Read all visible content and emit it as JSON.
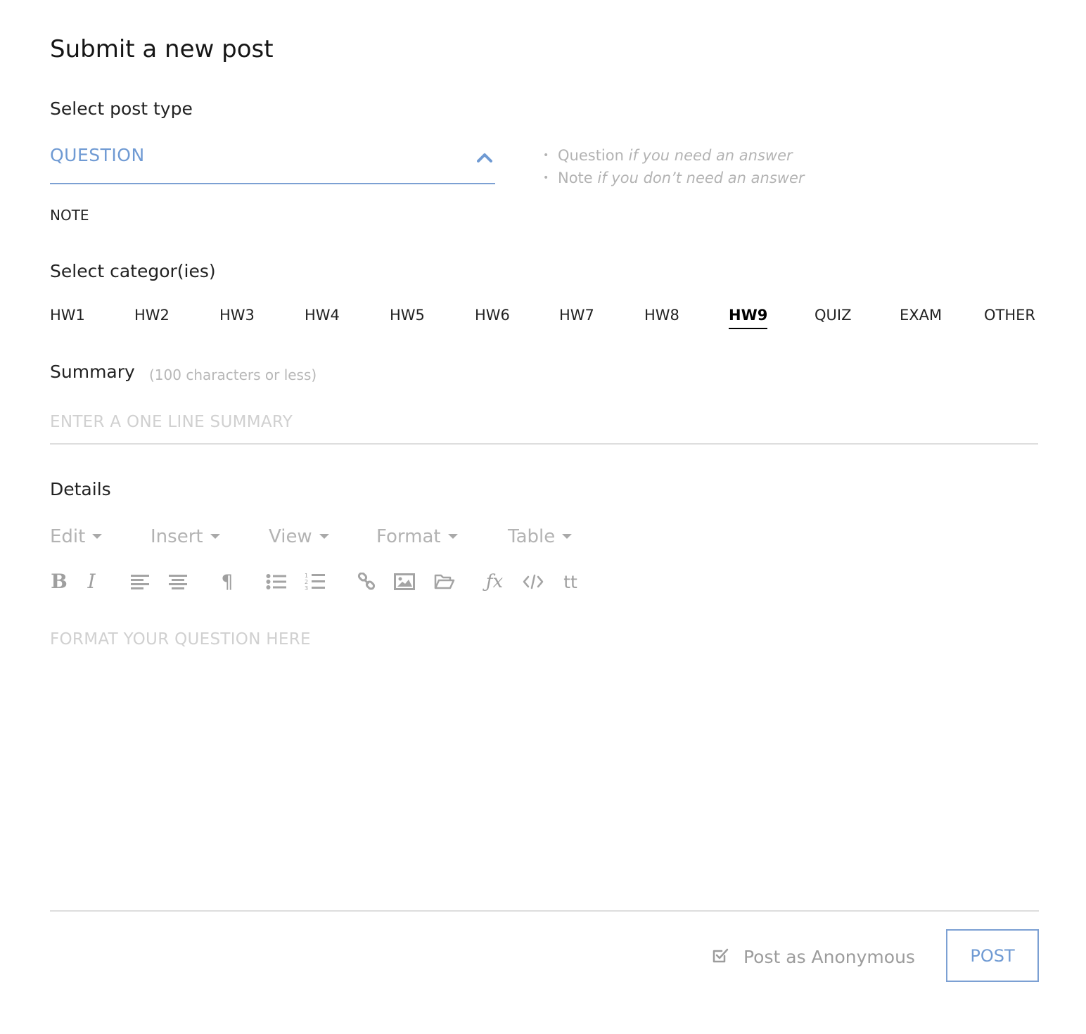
{
  "page": {
    "title": "Submit a new post"
  },
  "post_type": {
    "label": "Select post type",
    "selected": "QUESTION",
    "options": [
      "NOTE"
    ],
    "hints": [
      {
        "name": "Question",
        "desc": "if you need an answer"
      },
      {
        "name": "Note",
        "desc": "if you don’t need an answer"
      }
    ],
    "accent_color": "#6f9ad3"
  },
  "categories": {
    "label": "Select categor(ies)",
    "items": [
      "HW1",
      "HW2",
      "HW3",
      "HW4",
      "HW5",
      "HW6",
      "HW7",
      "HW8",
      "HW9",
      "QUIZ",
      "EXAM",
      "OTHER"
    ],
    "selected": "HW9"
  },
  "summary": {
    "label": "Summary",
    "hint": "(100 characters or less)",
    "placeholder": "ENTER A ONE LINE SUMMARY",
    "value": ""
  },
  "details": {
    "label": "Details",
    "menus": [
      "Edit",
      "Insert",
      "View",
      "Format",
      "Table"
    ],
    "toolbar": [
      {
        "icon": "bold-icon"
      },
      {
        "icon": "italic-icon"
      },
      {
        "icon": "align-left-icon"
      },
      {
        "icon": "align-center-icon"
      },
      {
        "icon": "paragraph-icon"
      },
      {
        "icon": "bullet-list-icon"
      },
      {
        "icon": "numbered-list-icon"
      },
      {
        "icon": "link-icon"
      },
      {
        "icon": "image-icon"
      },
      {
        "icon": "folder-open-icon"
      },
      {
        "icon": "formula-icon"
      },
      {
        "icon": "code-icon"
      },
      {
        "icon": "monospace-icon",
        "text": "tt"
      }
    ],
    "placeholder": "FORMAT YOUR QUESTION HERE"
  },
  "footer": {
    "anonymous_label": "Post as Anonymous",
    "anonymous_checked": true,
    "post_button": "POST"
  }
}
